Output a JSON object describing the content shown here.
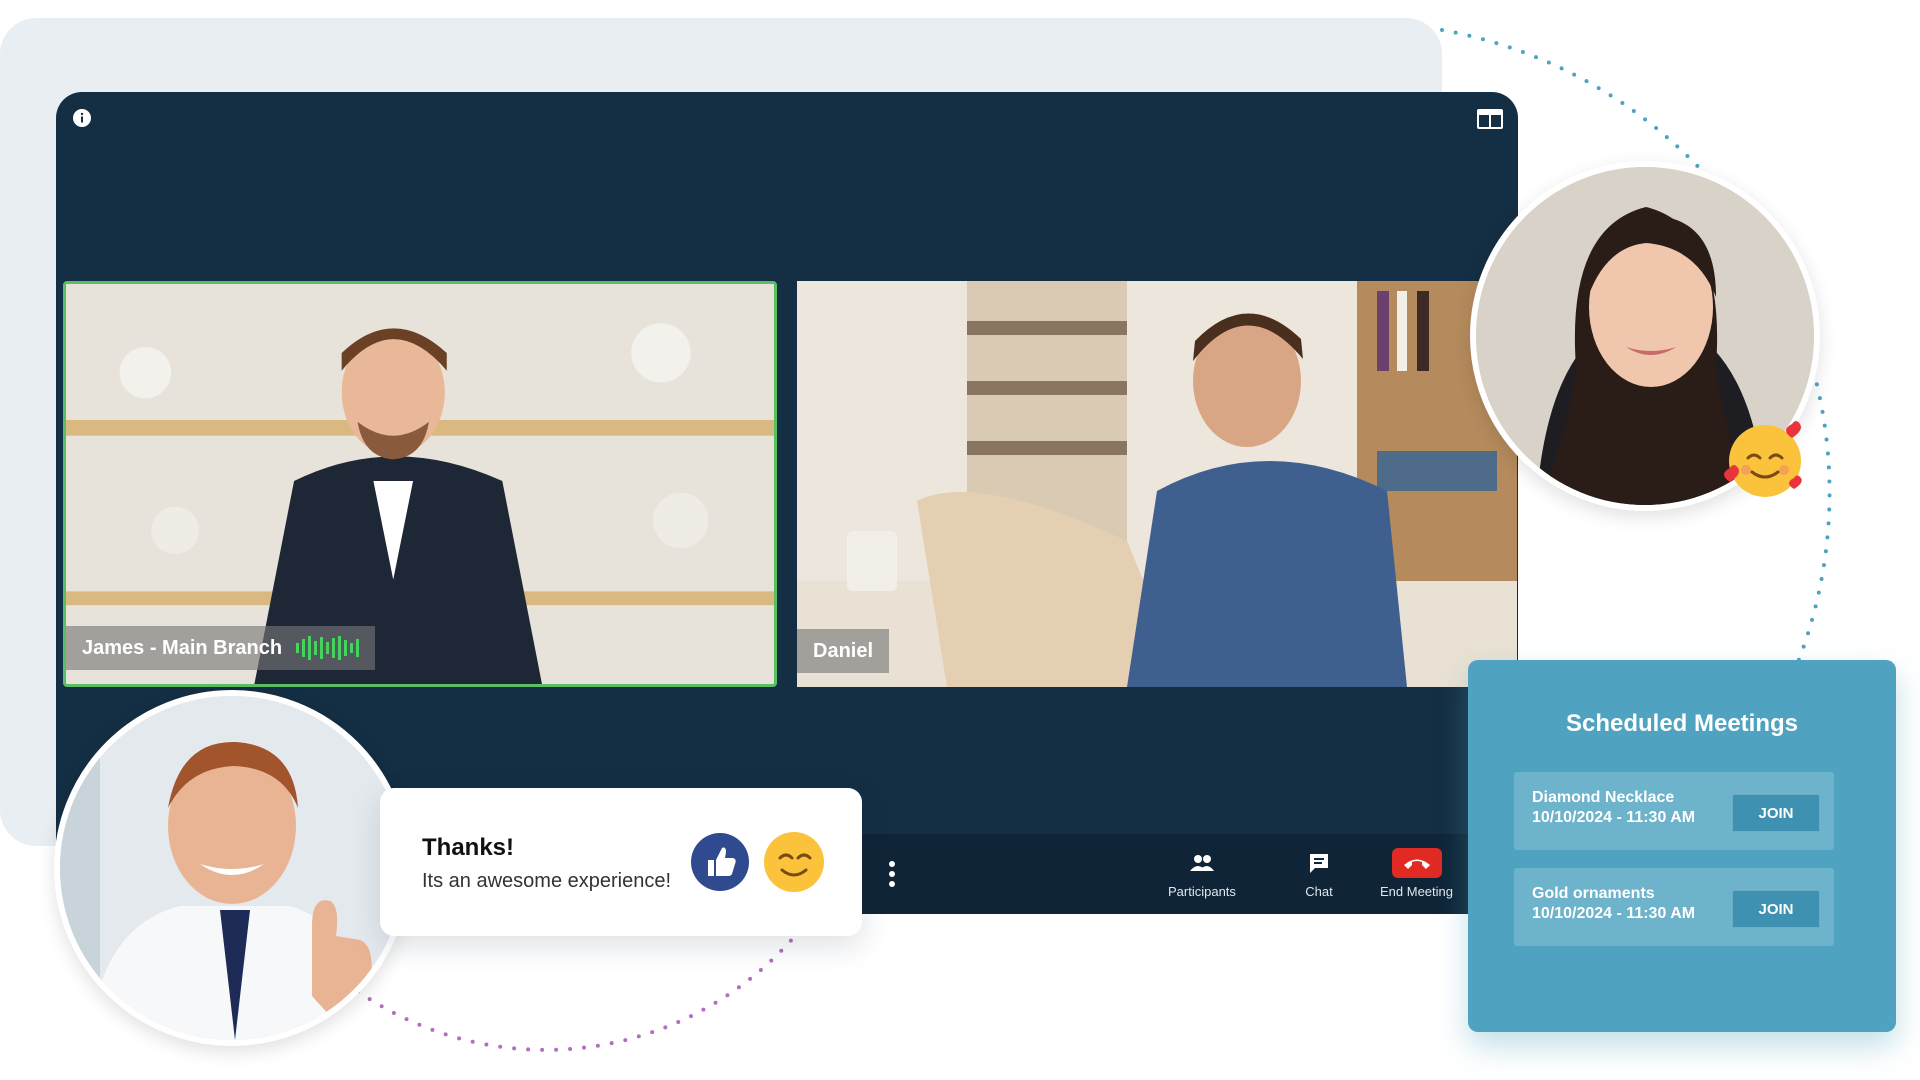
{
  "meeting": {
    "participants": [
      {
        "name": "James - Main Branch",
        "speaking": true
      },
      {
        "name": "Daniel",
        "speaking": false
      }
    ],
    "controls": {
      "participants_label": "Participants",
      "chat_label": "Chat",
      "end_label": "End Meeting"
    }
  },
  "comment": {
    "title": "Thanks!",
    "text": "Its an awesome experience!"
  },
  "scheduled": {
    "title": "Scheduled Meetings",
    "items": [
      {
        "name": "Diamond Necklace",
        "datetime": "10/10/2024 - 11:30 AM",
        "action": "JOIN"
      },
      {
        "name": "Gold ornaments",
        "datetime": "10/10/2024 - 11:30 AM",
        "action": "JOIN"
      }
    ]
  },
  "colors": {
    "accent": "#4fa3c1",
    "meeting_bg": "#142e43",
    "speaking": "#58c063",
    "end_call": "#e12a24"
  },
  "icons": [
    "info-icon",
    "layout-icon",
    "audio-wave-icon",
    "more-vertical-icon",
    "participants-icon",
    "chat-icon",
    "phone-hangup-icon",
    "thumbs-up-icon",
    "smile-emoji-icon",
    "hearts-emoji-icon"
  ]
}
